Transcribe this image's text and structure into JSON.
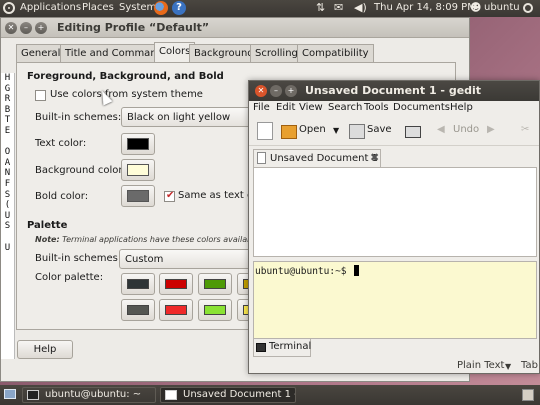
{
  "top_panel": {
    "menus": [
      "Applications",
      "Places",
      "System"
    ],
    "clock": "Thu Apr 14,  8:09 PM",
    "user": "ubuntu",
    "tray_icons": [
      "network-icon",
      "mail-icon",
      "volume-icon"
    ]
  },
  "terminal_dialog": {
    "title": "Editing Profile “Default”",
    "strip_text": [
      "H",
      "G",
      "R",
      "B",
      "T",
      "E",
      "",
      "O",
      "A",
      "N",
      "F",
      "S",
      "(",
      "U",
      "S",
      "",
      "U"
    ],
    "tabs": [
      "General",
      "Title and Command",
      "Colors",
      "Background",
      "Scrolling",
      "Compatibility"
    ],
    "active_tab": "Colors",
    "fg_section_title": "Foreground, Background, and Bold",
    "use_system_colors_label": "Use colors from system theme",
    "builtin_schemes_label": "Built-in schemes:",
    "builtin_schemes_value": "Black on light yellow",
    "text_color_label": "Text color:",
    "background_color_label": "Background color:",
    "bold_color_label": "Bold color:",
    "same_as_text_label": "Same as text co",
    "palette_title": "Palette",
    "note_bold": "Note:",
    "note_text": " Terminal applications have these colors available",
    "palette_schemes_label": "Built-in schemes:",
    "palette_schemes_value": "Custom",
    "color_palette_label": "Color palette:",
    "help_label": "Help",
    "colors": {
      "text": "#000000",
      "background": "#fffdd8",
      "bold": "#6a6a6a",
      "palette_row1": [
        "#2e3436",
        "#cc0000",
        "#4e9a06",
        "#c4a000"
      ],
      "palette_row2": [
        "#555753",
        "#ef2929",
        "#8ae234",
        "#fce94f"
      ]
    }
  },
  "gedit": {
    "title": "Unsaved Document 1 - gedit",
    "menus": [
      "File",
      "Edit",
      "View",
      "Search",
      "Tools",
      "Documents",
      "Help"
    ],
    "toolbar": {
      "open": "Open",
      "save": "Save",
      "undo": "Undo"
    },
    "doc_tab": "Unsaved Document 1",
    "terminal_prompt": "ubuntu@ubuntu:~$ ",
    "bottom_tab": "Terminal",
    "status_language": "Plain Text",
    "status_tab": "Tab W"
  },
  "bottom_panel": {
    "tasks": [
      "ubuntu@ubuntu: ~",
      "Unsaved Document 1 - ..."
    ]
  }
}
